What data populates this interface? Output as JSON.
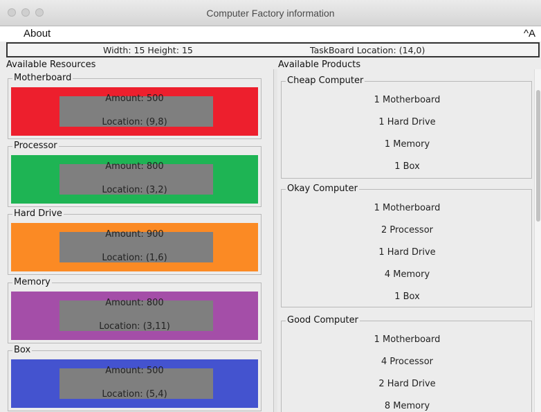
{
  "window": {
    "title": "Computer Factory information"
  },
  "menu": {
    "about": "About",
    "shortcut": "^A"
  },
  "info": {
    "size": "Width: 15 Height: 15",
    "taskboard": "TaskBoard Location: (14,0)"
  },
  "sections": {
    "resources": "Available Resources",
    "products": "Available Products"
  },
  "resources": [
    {
      "name": "Motherboard",
      "amount": "Amount: 500",
      "location": "Location: (9,8)",
      "color": "#ed1f2d"
    },
    {
      "name": "Processor",
      "amount": "Amount: 800",
      "location": "Location: (3,2)",
      "color": "#1eb454"
    },
    {
      "name": "Hard Drive",
      "amount": "Amount: 900",
      "location": "Location: (1,6)",
      "color": "#fb8a24"
    },
    {
      "name": "Memory",
      "amount": "Amount: 800",
      "location": "Location: (3,11)",
      "color": "#a44ea8"
    },
    {
      "name": "Box",
      "amount": "Amount: 500",
      "location": "Location: (5,4)",
      "color": "#4453cf"
    }
  ],
  "products": [
    {
      "name": "Cheap Computer",
      "parts": [
        "1 Motherboard",
        "1 Hard Drive",
        "1 Memory",
        "1 Box"
      ]
    },
    {
      "name": "Okay Computer",
      "parts": [
        "1 Motherboard",
        "2 Processor",
        "1 Hard Drive",
        "4 Memory",
        "1 Box"
      ]
    },
    {
      "name": "Good Computer",
      "parts": [
        "1 Motherboard",
        "4 Processor",
        "2 Hard Drive",
        "8 Memory"
      ]
    }
  ]
}
